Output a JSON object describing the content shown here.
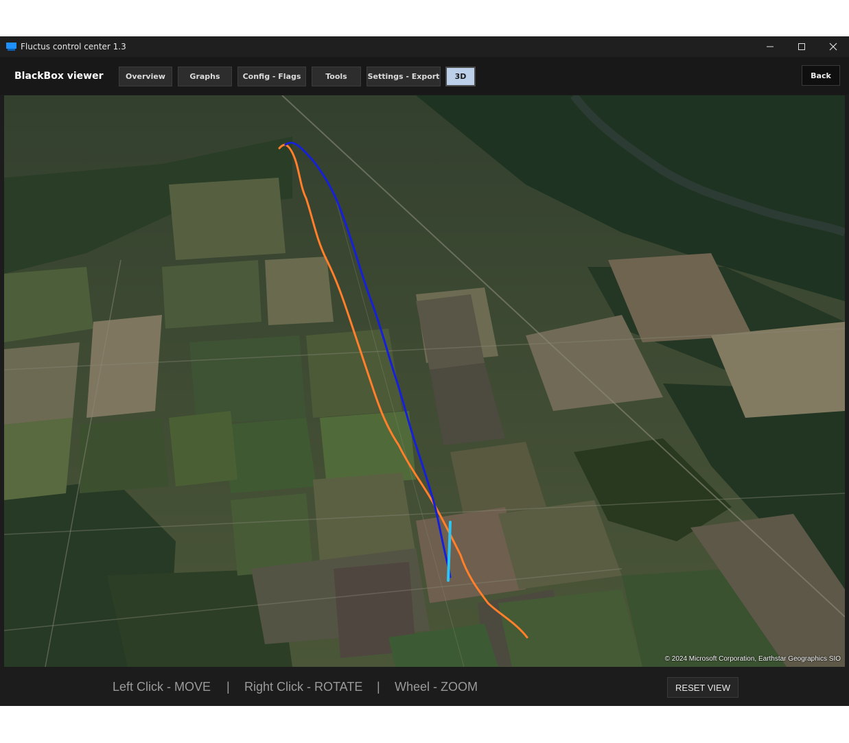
{
  "window": {
    "title": "Fluctus control center 1.3"
  },
  "toolbar": {
    "brand": "BlackBox viewer",
    "tabs": [
      {
        "label": "Overview"
      },
      {
        "label": "Graphs"
      },
      {
        "label": "Config - Flags"
      },
      {
        "label": "Tools"
      },
      {
        "label": "Settings - Export"
      },
      {
        "label": "3D",
        "active": true
      }
    ],
    "back_label": "Back"
  },
  "map": {
    "attribution": "© 2024 Microsoft Corporation, Earthstar Geographics SIO",
    "track_colors": {
      "orange": "#ff7f2a",
      "blue": "#1520d8",
      "cyan": "#2ec4f2"
    }
  },
  "footer": {
    "hints": [
      "Left Click - MOVE",
      "Right Click - ROTATE",
      "Wheel - ZOOM"
    ],
    "separator": "|",
    "reset_label": "RESET VIEW"
  },
  "icons": [
    "app-icon",
    "minimize-icon",
    "maximize-icon",
    "close-icon"
  ]
}
